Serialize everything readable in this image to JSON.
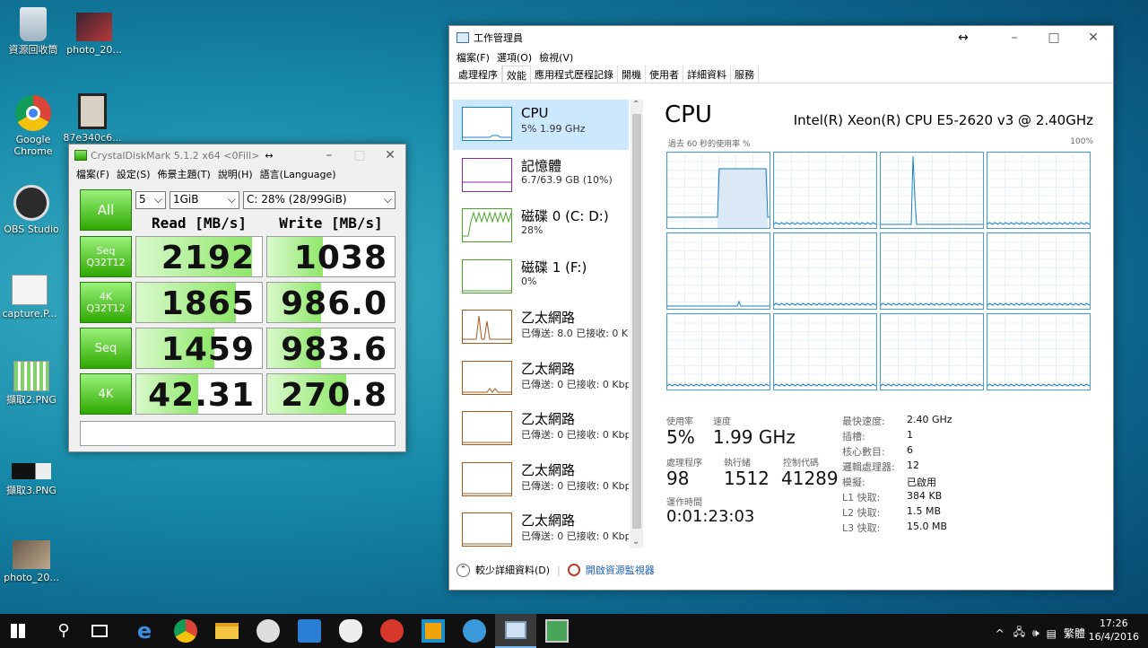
{
  "desktop": {
    "icons": [
      {
        "label": "資源回收筒"
      },
      {
        "label": "photo_20..."
      },
      {
        "label": "Google Chrome"
      },
      {
        "label": "87e340c6..."
      },
      {
        "label": "OBS Studio"
      },
      {
        "label": "capture.P..."
      },
      {
        "label": "擷取2.PNG"
      },
      {
        "label": "擷取3.PNG"
      },
      {
        "label": "photo_20..."
      }
    ]
  },
  "cdm": {
    "title": "CrystalDiskMark 5.1.2 x64 <0Fill>",
    "menu": [
      "檔案(F)",
      "設定(S)",
      "佈景主題(T)",
      "說明(H)",
      "語言(Language)"
    ],
    "all_label": "All",
    "count": "5",
    "size": "1GiB",
    "drive": "C: 28% (28/99GiB)",
    "read_header": "Read [MB/s]",
    "write_header": "Write [MB/s]",
    "rows": [
      {
        "line1": "Seq",
        "line2": "Q32T12",
        "read": "2192",
        "write": "1038",
        "read_fill": 0.92,
        "write_fill": 0.44
      },
      {
        "line1": "4K",
        "line2": "Q32T12",
        "read": "1865",
        "write": "986.0",
        "read_fill": 0.79,
        "write_fill": 0.42
      },
      {
        "line1": "Seq",
        "line2": "",
        "read": "1459",
        "write": "983.6",
        "read_fill": 0.62,
        "write_fill": 0.42
      },
      {
        "line1": "4K",
        "line2": "",
        "read": "42.31",
        "write": "270.8",
        "read_fill": 0.49,
        "write_fill": 0.62
      }
    ]
  },
  "tm": {
    "title": "工作管理員",
    "menu": [
      "檔案(F)",
      "選項(O)",
      "檢視(V)"
    ],
    "tabs": [
      "處理程序",
      "效能",
      "應用程式歷程記錄",
      "開機",
      "使用者",
      "詳細資料",
      "服務"
    ],
    "active_tab": 1,
    "perf_items": [
      {
        "name": "CPU",
        "sub": "5% 1.99 GHz",
        "color": "#1a7fc1"
      },
      {
        "name": "記憶體",
        "sub": "6.7/63.9 GB (10%)",
        "color": "#8b2aa5"
      },
      {
        "name": "磁碟 0 (C: D:)",
        "sub": "28%",
        "color": "#4aa52a"
      },
      {
        "name": "磁碟 1 (F:)",
        "sub": "0%",
        "color": "#4aa52a"
      },
      {
        "name": "乙太網路",
        "sub": "已傳送: 8.0 已接收: 0 Kb",
        "color": "#a7581b"
      },
      {
        "name": "乙太網路",
        "sub": "已傳送: 0 已接收: 0 Kbp",
        "color": "#a7581b"
      },
      {
        "name": "乙太網路",
        "sub": "已傳送: 0 已接收: 0 Kbp",
        "color": "#a7581b"
      },
      {
        "name": "乙太網路",
        "sub": "已傳送: 0 已接收: 0 Kbp",
        "color": "#a7581b"
      },
      {
        "name": "乙太網路",
        "sub": "已傳送: 0 已接收: 0 Kbp",
        "color": "#a7581b"
      }
    ],
    "cpu_title": "CPU",
    "cpu_model": "Intel(R) Xeon(R) CPU E5-2620 v3 @ 2.40GHz",
    "graph_label": "過去 60 秒的使用率 %",
    "graph_max": "100%",
    "stats": {
      "util_label": "使用率",
      "util": "5%",
      "speed_label": "速度",
      "speed": "1.99 GHz",
      "proc_label": "處理程序",
      "proc": "98",
      "threads_label": "執行緒",
      "threads": "1512",
      "handles_label": "控制代碼",
      "handles": "41289",
      "uptime_label": "運作時間",
      "uptime": "0:01:23:03"
    },
    "specs": [
      {
        "k": "最快速度:",
        "v": "2.40 GHz"
      },
      {
        "k": "插槽:",
        "v": "1"
      },
      {
        "k": "核心數目:",
        "v": "6"
      },
      {
        "k": "邏輯處理器:",
        "v": "12"
      },
      {
        "k": "模擬:",
        "v": "已啟用"
      },
      {
        "k": "L1 快取:",
        "v": "384 KB"
      },
      {
        "k": "L2 快取:",
        "v": "1.5 MB"
      },
      {
        "k": "L3 快取:",
        "v": "15.0 MB"
      }
    ],
    "fewer_details": "較少詳細資料(D)",
    "resmon": "開啟資源監視器"
  },
  "taskbar": {
    "lang": "繁體",
    "time": "17:26",
    "date": "16/4/2016"
  },
  "colors": {
    "cpu_line": "#1a7fc1",
    "cdm_green": "#2ea800",
    "taskbar": "#101010"
  }
}
